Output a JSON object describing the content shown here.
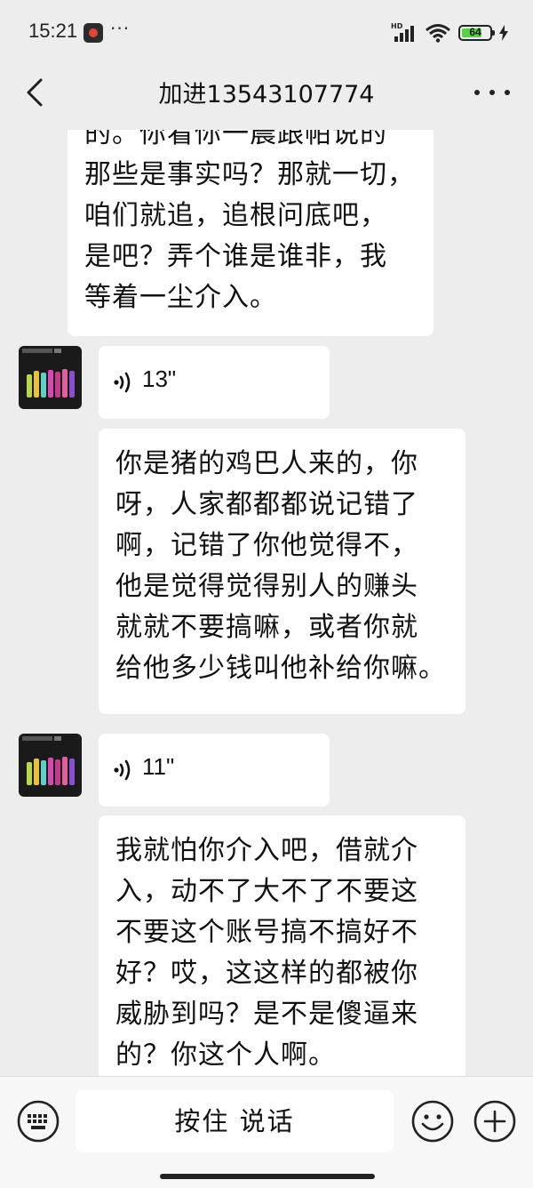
{
  "status_bar": {
    "time": "15:21",
    "more": "···",
    "network_label": "HD",
    "battery": "64"
  },
  "header": {
    "title": "加进13543107774"
  },
  "messages": [
    {
      "type": "text",
      "lines": [
        "的。你看你一晨跟帕说的",
        "那些是事实吗？那就一切，",
        "咱们就追，追根问底吧，",
        "是吧？弄个谁是谁非，我",
        "等着一尘介入。"
      ]
    },
    {
      "type": "voice",
      "duration": "13\""
    },
    {
      "type": "text",
      "lines": [
        "你是猪的鸡巴人来的，你",
        "呀，人家都都都说记错了",
        "啊，记错了你他觉得不，",
        "他是觉得觉得别人的赚头",
        "就就不要搞嘛，或者你就",
        "给他多少钱叫他补给你嘛。"
      ]
    },
    {
      "type": "voice",
      "duration": "11\""
    },
    {
      "type": "text",
      "lines": [
        "我就怕你介入吧，借就介",
        "入，动不了大不了不要这",
        "不要这个账号搞不搞好不",
        "好？哎，这这样的都被你",
        "威胁到吗？是不是傻逼来",
        "的？你这个人啊。"
      ]
    }
  ],
  "input_bar": {
    "hold_to_talk": "按住 说话"
  },
  "colors": {
    "background": "#ededed",
    "bubble": "#ffffff",
    "bottom_bar": "#f7f7f7"
  },
  "icons": [
    "back-icon",
    "more-icon",
    "voice-wave-icon",
    "keyboard-icon",
    "emoji-icon",
    "plus-icon",
    "wifi-icon",
    "signal-icon",
    "battery-icon",
    "charging-icon"
  ]
}
